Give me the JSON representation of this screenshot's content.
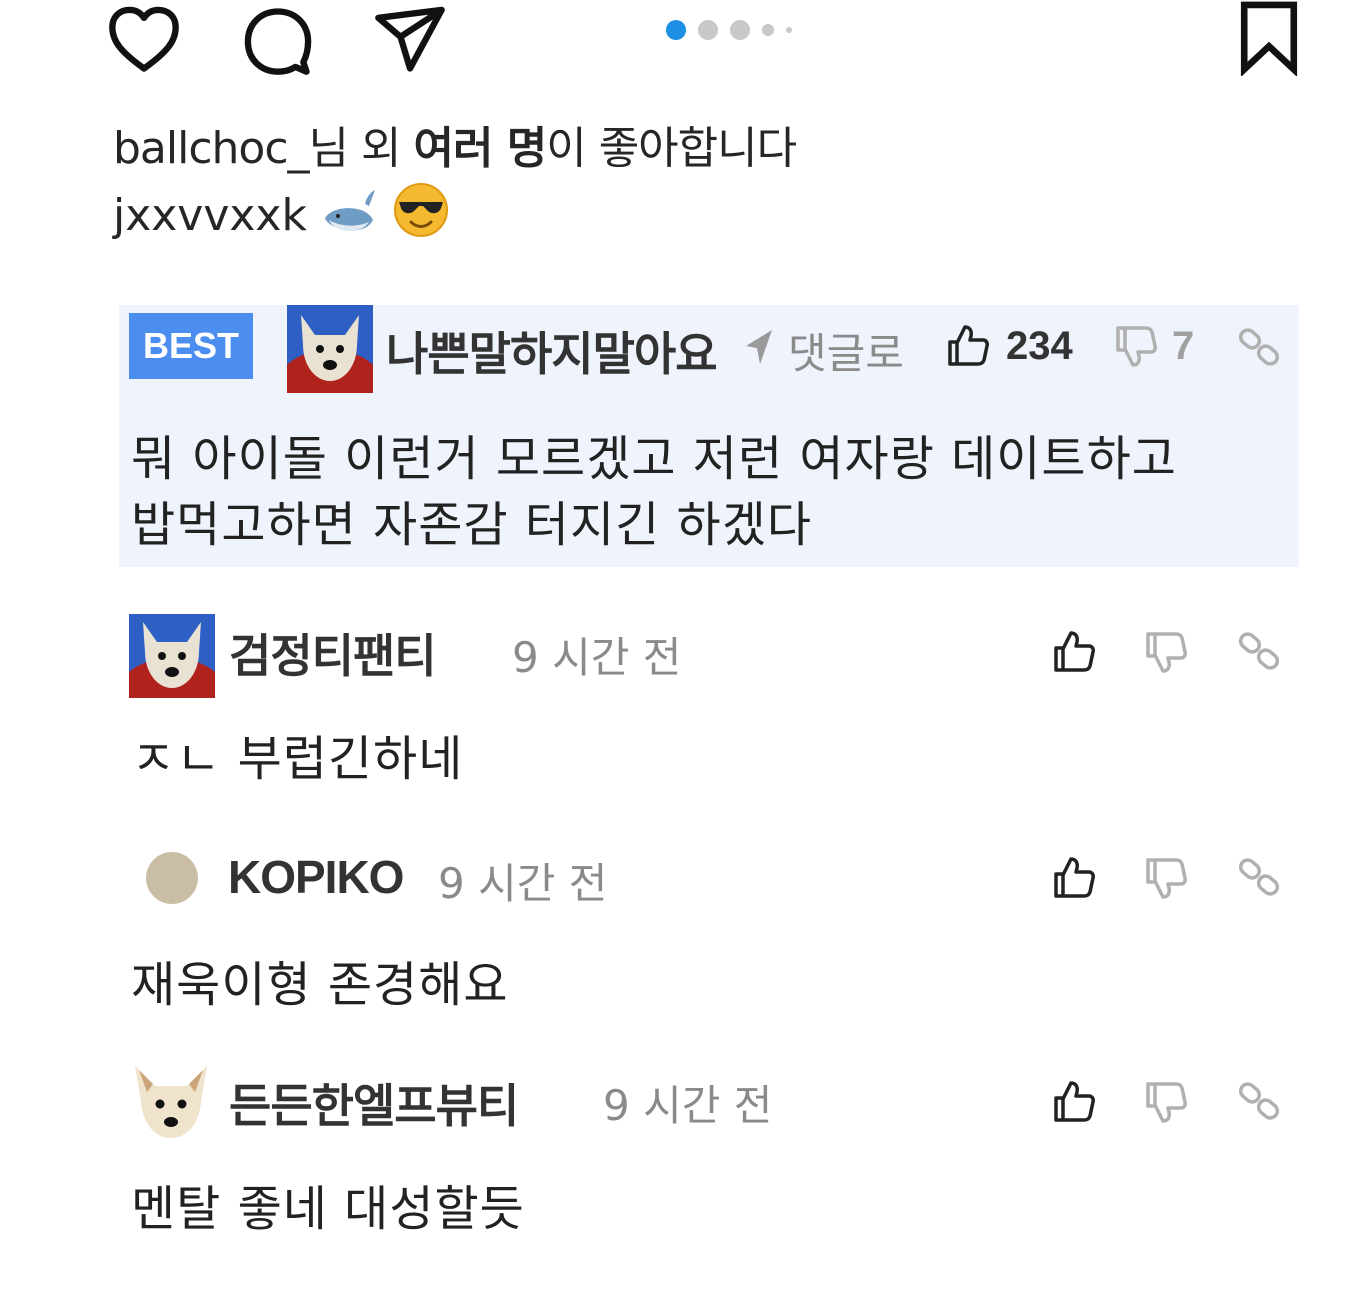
{
  "post": {
    "pagination_dots": 5,
    "active_dot": 0,
    "likes_user": "ballchoc_",
    "likes_mid": "님 외 ",
    "likes_bold": "여러 명",
    "likes_tail": "이 좋아합니다",
    "caption_user": "jxxvvxxk",
    "caption_emojis": [
      "whale",
      "sunglasses-face"
    ]
  },
  "comments": {
    "best": {
      "badge": "BEST",
      "nickname": "나쁜말하지말아요",
      "reply_label": "댓글로",
      "likes": "234",
      "dislikes": "7",
      "body_line1": "뭐 아이돌 이런거 모르겠고 저런 여자랑 데이트하고",
      "body_line2": "밥먹고하면 자존감 터지긴 하겠다"
    },
    "items": [
      {
        "nickname": "검정티팬티",
        "time": "9 시간 전",
        "body": "ㅈㄴ 부럽긴하네"
      },
      {
        "nickname": "KOPIKO",
        "time": "9 시간 전",
        "body": "재욱이형 존경해요"
      },
      {
        "nickname": "든든한엘프뷰티",
        "time": "9 시간 전",
        "body": "멘탈 좋네 대성할듯"
      }
    ]
  },
  "colors": {
    "accent_blue": "#4c8df0",
    "best_bg": "#eef3fc",
    "ig_dot_active": "#1e90e6"
  }
}
